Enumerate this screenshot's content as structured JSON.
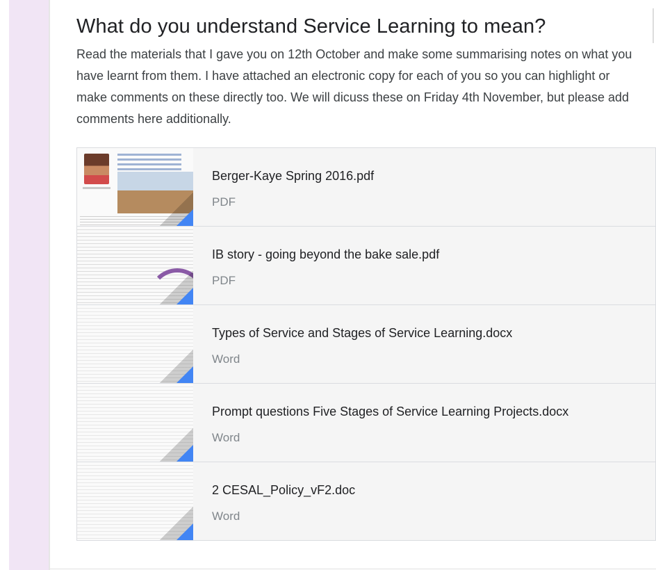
{
  "post": {
    "title": "What do you understand Service Learning to mean?",
    "description": "Read the materials that I gave you on 12th October and make some summarising notes on what you have learnt from them. I have attached an electronic copy for each of you so you can highlight or make comments on these directly too. We will dicuss these on Friday 4th November, but please add comments here additionally."
  },
  "attachments": [
    {
      "name": "Berger-Kaye Spring 2016.pdf",
      "type": "PDF"
    },
    {
      "name": "IB story - going beyond the bake sale.pdf",
      "type": "PDF"
    },
    {
      "name": "Types of Service and Stages of Service Learning.docx",
      "type": "Word"
    },
    {
      "name": "Prompt questions Five Stages of Service Learning Projects.docx",
      "type": "Word"
    },
    {
      "name": "2 CESAL_Policy_vF2.doc",
      "type": "Word"
    }
  ],
  "colors": {
    "accent": "#4285f4",
    "left_band": "#f1e5f5",
    "title_text": "#202124",
    "body_text": "#3c4043",
    "type_text": "#80868b"
  },
  "icons": {
    "attachment_corner": "file-type-corner-icon"
  }
}
